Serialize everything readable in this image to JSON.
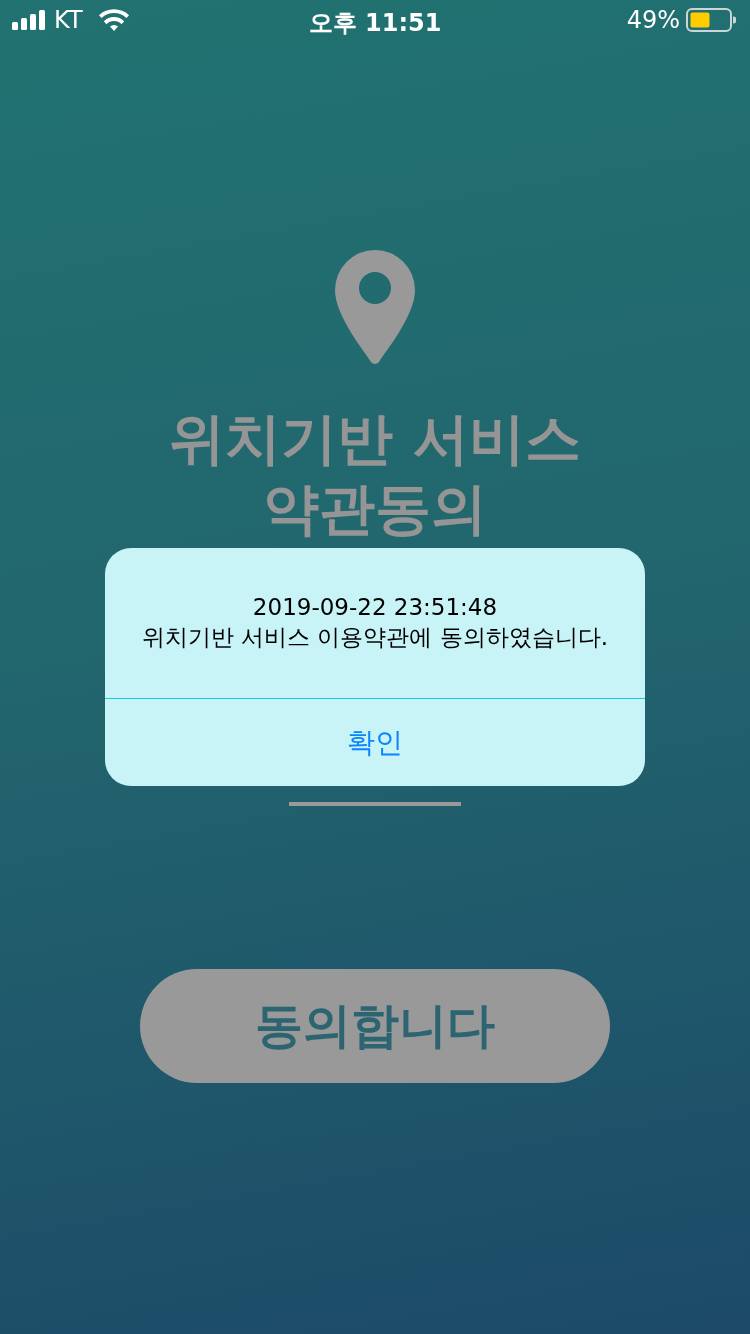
{
  "status_bar": {
    "carrier": "KT",
    "time": "오후 11:51",
    "battery": "49%"
  },
  "screen": {
    "title_lines": [
      "위치기반 서비스",
      "약관동의"
    ],
    "agree_button": "동의합니다"
  },
  "alert": {
    "message_lines": [
      "2019-09-22 23:51:48",
      "위치기반 서비스 이용약관에 동의하였습니다."
    ],
    "button": "확인"
  }
}
